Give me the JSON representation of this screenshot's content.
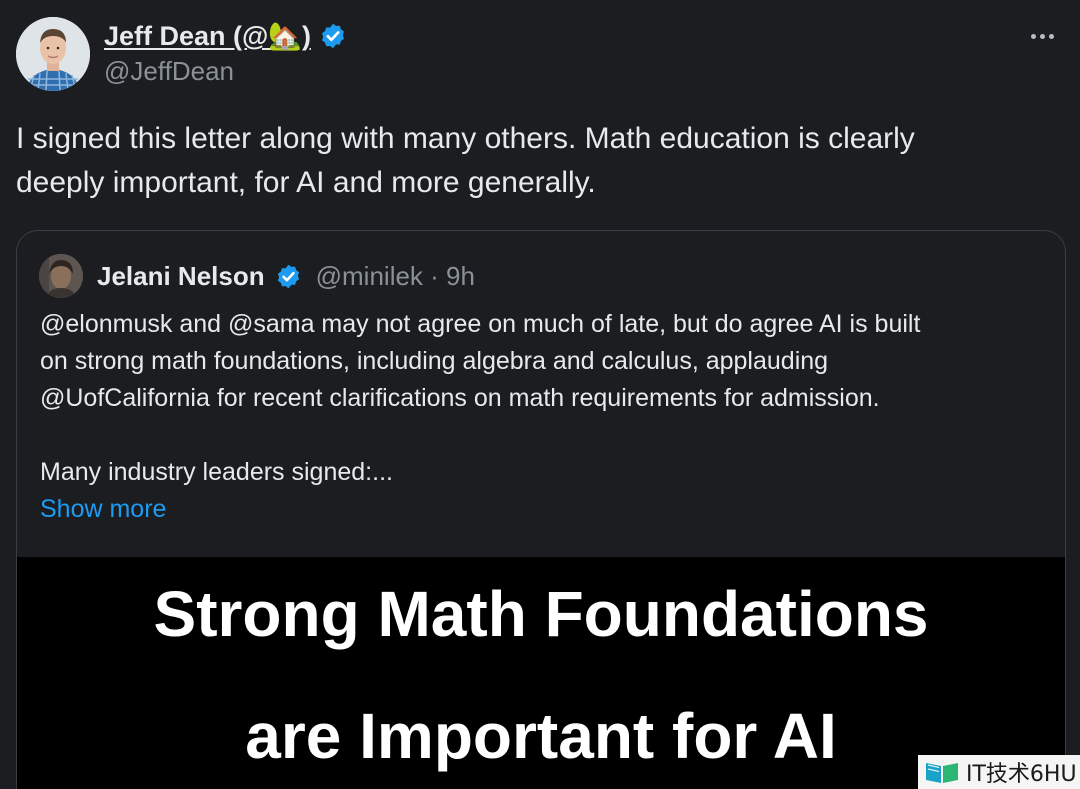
{
  "author": {
    "display_name": "Jeff Dean (@🏡)",
    "handle": "@JeffDean",
    "verified": true
  },
  "tweet": {
    "text_lines": [
      "I signed this letter along with many others.  Math education is clearly",
      "deeply important, for AI and more generally."
    ]
  },
  "quote": {
    "display_name": "Jelani Nelson",
    "handle_time": "@minilek · 9h",
    "verified": true,
    "body_lines": [
      "@elonmusk and @sama may not agree on much of late, but do agree AI is built",
      "on strong math foundations, including algebra and calculus, applauding",
      "@UofCalifornia for recent clarifications on math requirements for admission.",
      "Many industry leaders signed:..."
    ],
    "show_more_label": "Show more",
    "media": {
      "line1": "Strong Math Foundations",
      "line2": "are Important for AI"
    }
  },
  "watermark": {
    "text": "IT技术6HU"
  },
  "colors": {
    "background": "#1b1d21",
    "text": "#e7e9ea",
    "secondary_text": "#8b9198",
    "link": "#1d9bf0",
    "verified": "#1d9bf0"
  },
  "icons": {
    "verified": "verified-badge-icon",
    "more": "more-horizontal-icon"
  }
}
